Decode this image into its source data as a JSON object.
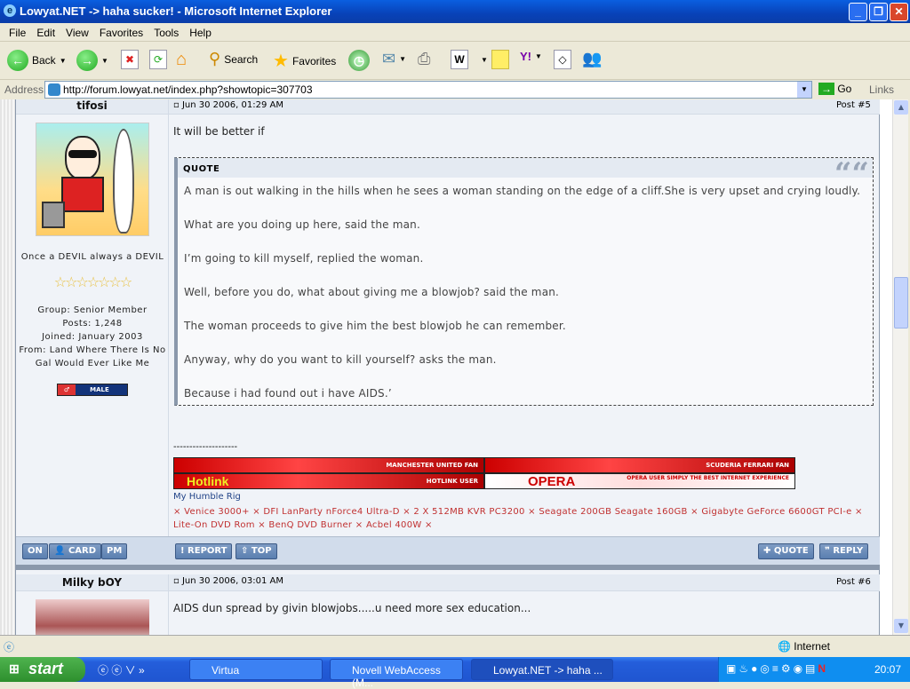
{
  "window": {
    "title": "Lowyat.NET -> haha sucker! - Microsoft Internet Explorer"
  },
  "menu": [
    "File",
    "Edit",
    "View",
    "Favorites",
    "Tools",
    "Help"
  ],
  "toolbar": {
    "back": "Back",
    "search": "Search",
    "favorites": "Favorites"
  },
  "address": {
    "label": "Address",
    "url": "http://forum.lowyat.net/index.php?showtopic=307703",
    "go": "Go",
    "links": "Links"
  },
  "post5": {
    "username": "tifosi",
    "date": "Jun 30 2006, 01:29 AM",
    "post_no": "Post #5",
    "title_line": "Once a DEVIL always a DEVIL",
    "stars": 7,
    "group": "Group: Senior Member",
    "posts": "Posts: 1,248",
    "joined": "Joined: January 2003",
    "from": "From: Land Where There Is No Gal Would Ever Like Me",
    "gender": "MALE",
    "text": "It will be better if",
    "quote_label": "QUOTE",
    "quote_lines": [
      "A man is out walking in the hills when he sees a woman standing on the edge of a cliff.She is very upset and crying loudly.",
      "What are you doing up here, said the man.",
      "I’m going to kill myself, replied the woman.",
      "Well, before you do, what about giving me a blowjob? said the man.",
      "The woman proceeds to give him the best blowjob he can remember.",
      "Anyway, why do you want to kill yourself? asks the man.",
      "Because i had found out i have AIDS.’"
    ],
    "sig_divider": "--------------------",
    "banners": [
      "MANCHESTER UNITED FAN",
      "SCUDERIA FERRARI FAN",
      "HOTLINK USER",
      "OPERA USER SIMPLY THE BEST INTERNET EXPERIENCE"
    ],
    "banner_logos": [
      "Hotlink",
      "OPERA"
    ],
    "rig_title": "My Humble Rig",
    "rig": "× Venice 3000+ × DFI LanParty nForce4 Ultra-D × 2 X 512MB KVR PC3200 × Seagate 200GB Seagate 160GB × Gigabyte GeForce 6600GT PCI-e × Lite-On DVD Rom × BenQ DVD Burner × Acbel 400W ×",
    "left_buttons": [
      "ON",
      "CARD",
      "PM"
    ],
    "buttons": {
      "report": "REPORT",
      "top": "TOP",
      "quote": "QUOTE",
      "reply": "REPLY"
    }
  },
  "post6": {
    "username": "Milky bOY",
    "date": "Jun 30 2006, 03:01 AM",
    "post_no": "Post #6",
    "text": "AIDS dun spread by givin blowjobs.....u need more sex education..."
  },
  "status": {
    "zone": "Internet"
  },
  "taskbar": {
    "start": "start",
    "tasks": [
      "Virtua",
      "Novell WebAccess (M...",
      "Lowyat.NET -> haha ..."
    ],
    "clock": "20:07"
  }
}
